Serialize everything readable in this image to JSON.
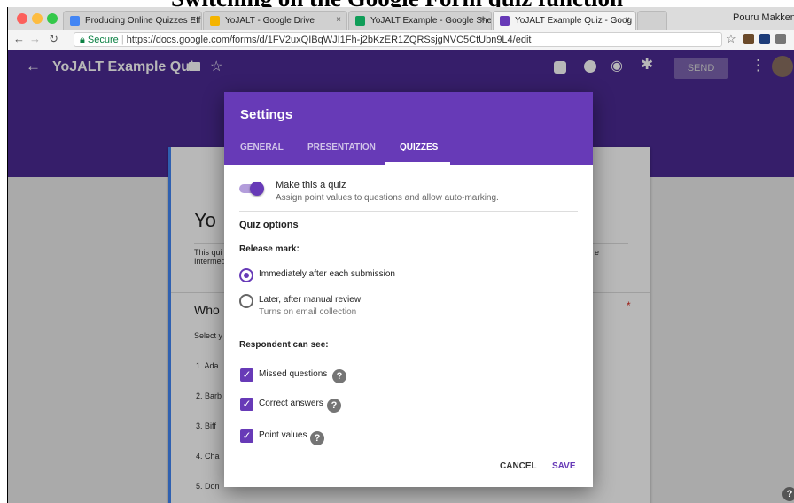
{
  "slide_title": "Switching on the Google Form quiz function",
  "browser": {
    "tabs": [
      {
        "label": "Producing Online Quizzes Effi",
        "close": "×",
        "icon_color": "#4285f4"
      },
      {
        "label": "YoJALT - Google Drive",
        "close": "×",
        "icon_color": "#f4b400"
      },
      {
        "label": "YoJALT Example - Google She",
        "close": "×",
        "icon_color": "#0f9d58"
      },
      {
        "label": "YoJALT Example Quiz - Goog",
        "close": "×",
        "icon_color": "#673ab7"
      }
    ],
    "profile_name": "Pouru Makken",
    "secure_label": "Secure",
    "url": "https://docs.google.com/forms/d/1FV2uxQIBqWJI1Fh-j2bKzER1ZQRSsjgNVC5CtUbn9L4/edit"
  },
  "header": {
    "form_title": "YoJALT Example Quiz",
    "send_label": "SEND"
  },
  "form": {
    "title_partial": "Yo",
    "desc_partial_1": "This qui",
    "desc_partial_2": "Intermed",
    "desc_tail": "e",
    "question_partial": "Who",
    "required_star": "*",
    "select_partial": "Select y",
    "options": [
      "1. Ada",
      "2. Barb",
      "3. Biff",
      "4. Cha",
      "5. Don"
    ]
  },
  "dialog": {
    "title": "Settings",
    "tabs": [
      "GENERAL",
      "PRESENTATION",
      "QUIZZES"
    ],
    "make_quiz_label": "Make this a quiz",
    "make_quiz_desc": "Assign point values to questions and allow auto-marking.",
    "quiz_options_heading": "Quiz options",
    "release_mark_heading": "Release mark:",
    "release_options": [
      {
        "label": "Immediately after each submission",
        "sub": "",
        "selected": true
      },
      {
        "label": "Later, after manual review",
        "sub": "Turns on email collection",
        "selected": false
      }
    ],
    "respondent_heading": "Respondent can see:",
    "respondent_options": [
      {
        "label": "Missed questions",
        "checked": true
      },
      {
        "label": "Correct answers",
        "checked": true
      },
      {
        "label": "Point values",
        "checked": true
      }
    ],
    "cancel_label": "CANCEL",
    "save_label": "SAVE"
  },
  "colors": {
    "header_purple": "#4b2a94",
    "dialog_purple": "#673ab7",
    "toggle_on": "#7e57c2"
  }
}
